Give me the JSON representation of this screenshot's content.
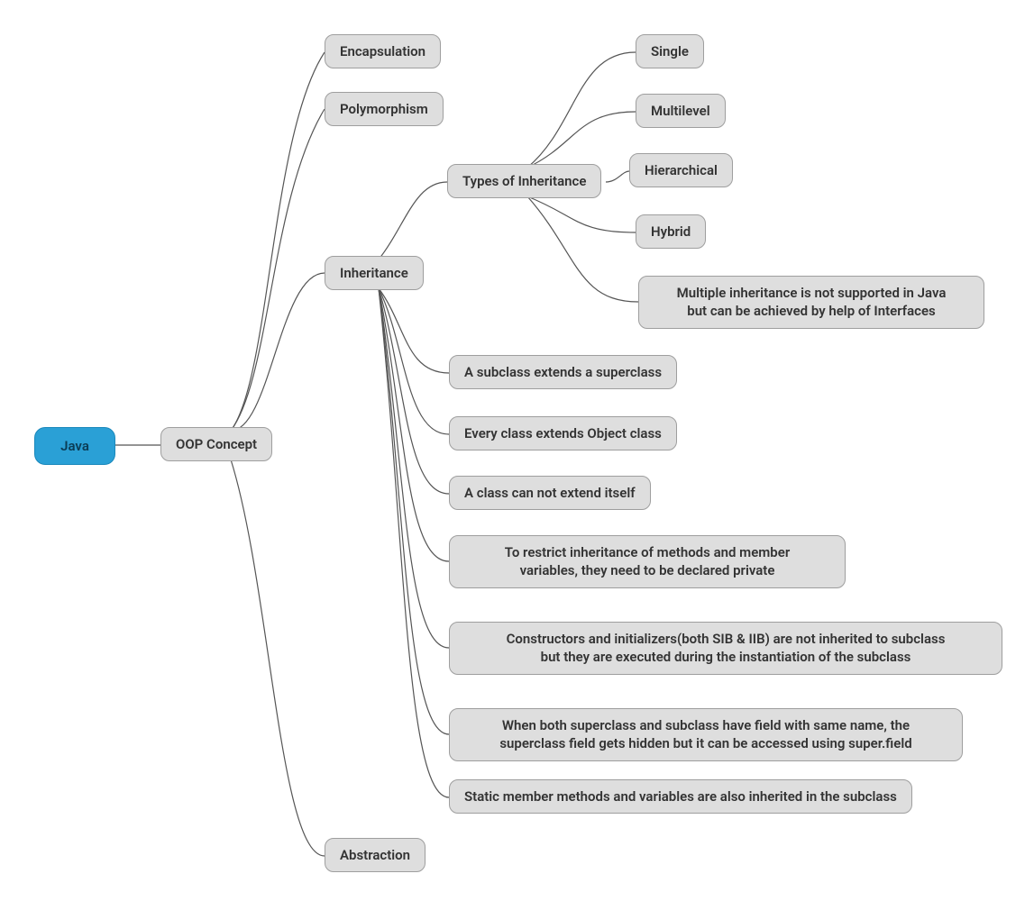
{
  "root": {
    "label": "Java"
  },
  "level1": {
    "label": "OOP Concept"
  },
  "oop": {
    "encapsulation": "Encapsulation",
    "polymorphism": "Polymorphism",
    "inheritance": "Inheritance",
    "abstraction": "Abstraction"
  },
  "inheritance": {
    "types": {
      "label": "Types of Inheritance",
      "items": {
        "single": "Single",
        "multilevel": "Multilevel",
        "hierarchical": "Hierarchical",
        "hybrid": "Hybrid",
        "multiple_note": "Multiple inheritance is not supported in Java\nbut can be achieved by help of Interfaces"
      }
    },
    "facts": {
      "subclass_extends": "A subclass extends a superclass",
      "extends_object": "Every class extends Object class",
      "not_self": "A class can not extend itself",
      "private_restrict": "To restrict inheritance of methods and member\nvariables, they need to be declared private",
      "constructors": "Constructors and initializers(both SIB & IIB) are not inherited to subclass\nbut they are executed during the instantiation of the subclass",
      "hidden_field": "When both superclass and subclass have field with same name, the\nsuperclass field gets hidden but it can be accessed using super.field",
      "static_inherited": "Static member methods and variables are also inherited in the subclass"
    }
  }
}
